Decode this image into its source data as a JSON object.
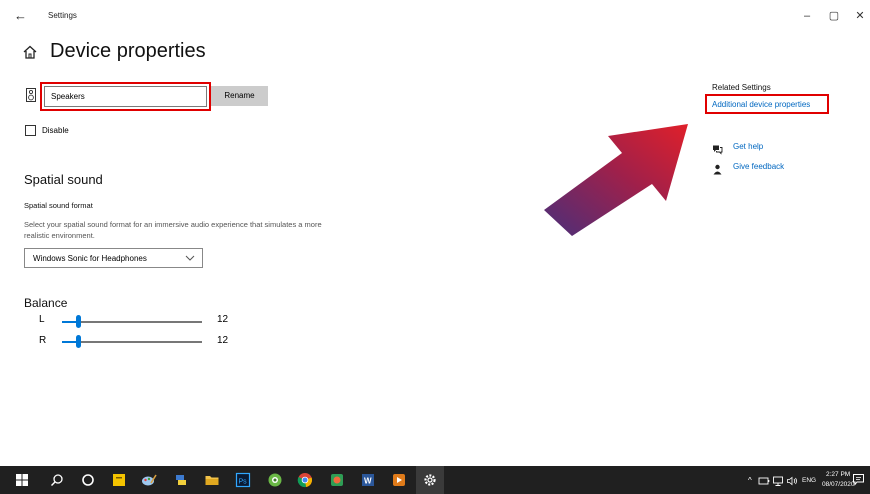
{
  "window": {
    "title": "Settings",
    "back_glyph": "←",
    "minimize_glyph": "–",
    "maximize_glyph": "▢",
    "close_glyph": "✕"
  },
  "page": {
    "title": "Device properties"
  },
  "device": {
    "name_value": "Speakers",
    "rename_label": "Rename",
    "disable_label": "Disable",
    "disable_checked": false
  },
  "spatial": {
    "section_title": "Spatial sound",
    "format_label": "Spatial sound format",
    "description": "Select your spatial sound format for an immersive audio experience that simulates a more realistic environment.",
    "selected_option": "Windows Sonic for Headphones"
  },
  "balance": {
    "title": "Balance",
    "left": {
      "label": "L",
      "value": "12",
      "level": 0.12
    },
    "right": {
      "label": "R",
      "value": "12",
      "level": 0.12
    }
  },
  "related": {
    "title": "Related Settings",
    "link": "Additional device properties",
    "help": "Get help",
    "feedback": "Give feedback"
  },
  "colors": {
    "accent": "#0078d7",
    "link": "#0067c0",
    "highlight": "#e00000",
    "taskbar": "#202020"
  },
  "taskbar": {
    "icons": [
      "windows-start",
      "search",
      "cortana",
      "sticky-notes",
      "paint",
      "python",
      "file-explorer",
      "photoshop",
      "greenshot",
      "chrome",
      "camtasia",
      "word",
      "sound-app",
      "settings"
    ],
    "tray_language": "ENG",
    "time": "2:27 PM",
    "date": "08/07/2020"
  }
}
